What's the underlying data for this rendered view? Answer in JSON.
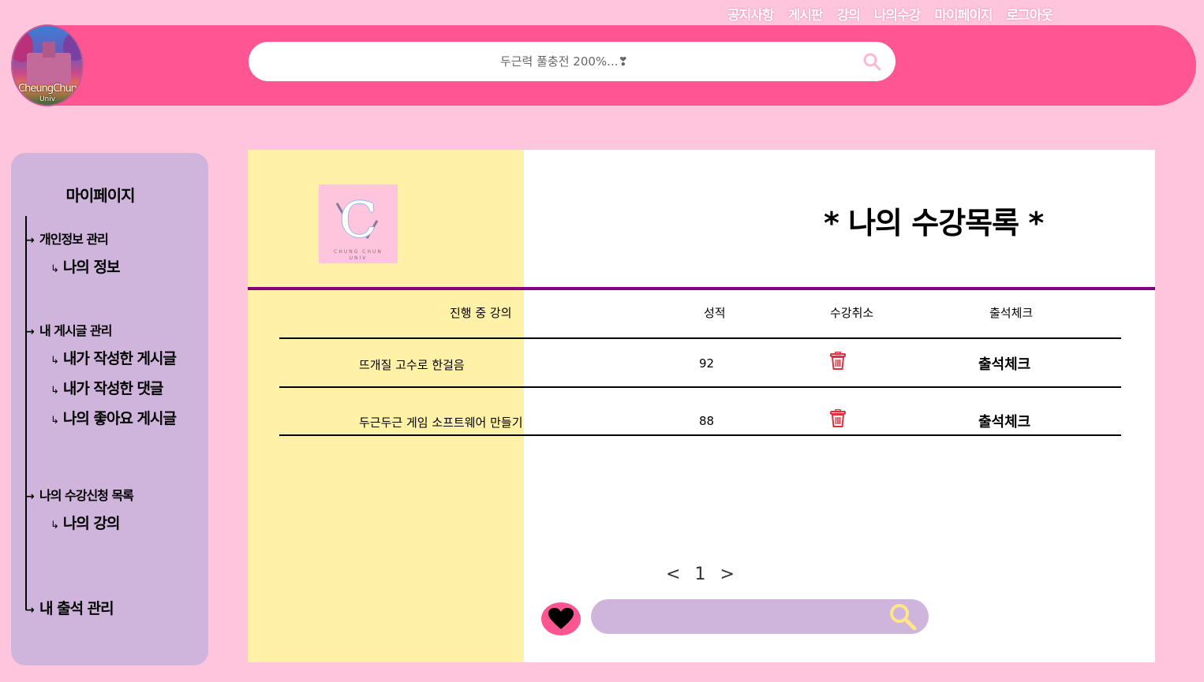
{
  "nav": {
    "items": [
      "공지사항",
      "게시판",
      "강의",
      "나의수강",
      "마이페이지",
      "로그아웃"
    ]
  },
  "logo": {
    "line1": "CheungChun",
    "line2": "Univ"
  },
  "search": {
    "placeholder": "두근력 풀충전 200%...❣"
  },
  "sidebar": {
    "title": "마이페이지",
    "sections": [
      {
        "label": "개인정보 관리",
        "subs": [
          "나의 정보"
        ]
      },
      {
        "label": "내 게시글 관리",
        "subs": [
          "내가 작성한 게시글",
          "내가 작성한 댓글",
          "나의 좋아요 게시글"
        ]
      },
      {
        "label": "나의 수강신청 목록",
        "subs": [
          "나의 강의"
        ]
      },
      {
        "label": "내 출석 관리",
        "subs": []
      }
    ]
  },
  "emblem": {
    "letter": "C",
    "line1": "CHUNG CHUN",
    "line2": "UNIV"
  },
  "panel": {
    "title": "* 나의 수강목록 *"
  },
  "table": {
    "headers": [
      "진행 중 강의",
      "성적",
      "수강취소",
      "출석체크"
    ],
    "rows": [
      {
        "course": "뜨개질 고수로 한걸음",
        "grade": "92",
        "attend": "출석체크"
      },
      {
        "course": "두근두근 게임 소프트웨어 만들기",
        "grade": "88",
        "attend": "출석체크"
      }
    ]
  },
  "pager": {
    "prev": "<",
    "page": "1",
    "next": ">"
  },
  "colors": {
    "background": "#ffc5dc",
    "header": "#ff5592",
    "sidebar": "#cfb4dc",
    "panel_left": "#fff1a8",
    "rule": "#800080",
    "trash": "#e0303c"
  },
  "icons": {
    "search": "search-icon",
    "trash": "trash-icon",
    "heart": "heart-icon"
  }
}
